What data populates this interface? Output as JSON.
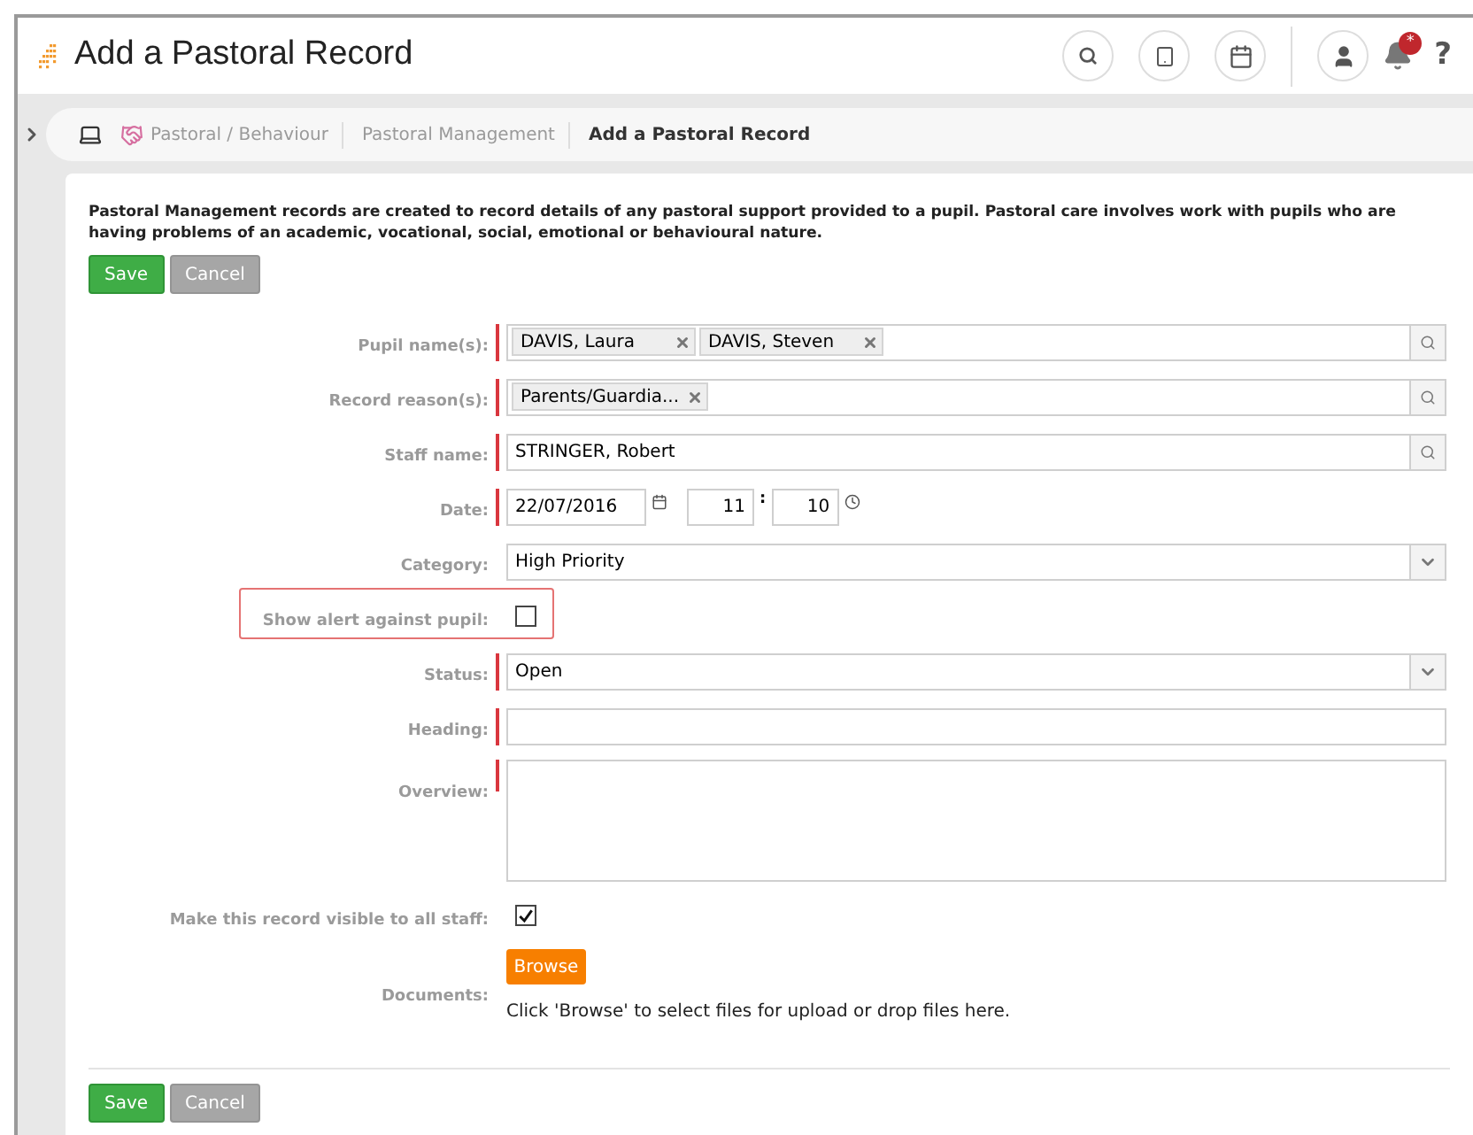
{
  "header": {
    "title": "Add a Pastoral Record",
    "notification_badge": "*",
    "help": "?"
  },
  "breadcrumb": [
    {
      "label": "Pastoral / Behaviour",
      "kind": "module"
    },
    {
      "label": "Pastoral Management",
      "kind": "link"
    },
    {
      "label": "Add a Pastoral Record",
      "kind": "current"
    }
  ],
  "intro": "Pastoral Management records are created to record details of any pastoral support provided to a pupil. Pastoral care involves work with pupils who are having problems of an academic, vocational, social, emotional or behavioural nature.",
  "top_buttons": [
    {
      "label": "Save",
      "kind": "primary"
    },
    {
      "label": "Cancel",
      "kind": "secondary"
    }
  ],
  "fields": [
    {
      "label": "Pupil name(s):",
      "kind": "tags",
      "required": true,
      "tags": [
        "DAVIS, Laura",
        "DAVIS, Steven"
      ]
    },
    {
      "label": "Record reason(s):",
      "kind": "tags",
      "required": true,
      "tags": [
        "Parents/Guardia..."
      ]
    },
    {
      "label": "Staff name:",
      "kind": "lookup",
      "required": true,
      "value": "STRINGER, Robert"
    },
    {
      "label": "Date:",
      "kind": "datetime",
      "required": true,
      "value": "22/07/2016",
      "hour": "11",
      "separator": ":",
      "minute": "10"
    },
    {
      "label": "Category:",
      "kind": "select",
      "required": false,
      "value": "High Priority"
    },
    {
      "label": "Show alert against pupil:",
      "kind": "checkbox",
      "required": false,
      "checked": false,
      "highlighted": true
    },
    {
      "label": "Status:",
      "kind": "select",
      "required": true,
      "value": "Open"
    },
    {
      "label": "Heading:",
      "kind": "text",
      "required": true
    },
    {
      "label": "Overview:",
      "kind": "textarea",
      "required": true
    },
    {
      "label": "Make this record visible to all staff:",
      "kind": "checkbox",
      "required": false,
      "checked": true,
      "highlighted": false
    },
    {
      "label": "Documents:",
      "kind": "file",
      "required": false,
      "button": "Browse",
      "hint": "Click 'Browse' to select files for upload or drop files here."
    }
  ],
  "bottom_buttons": [
    {
      "label": "Save",
      "kind": "primary"
    },
    {
      "label": "Cancel",
      "kind": "secondary"
    }
  ]
}
